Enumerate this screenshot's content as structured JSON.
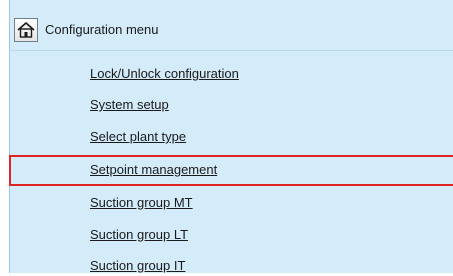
{
  "header": {
    "home_icon": "home-icon",
    "title": "Configuration menu"
  },
  "menu": {
    "items": [
      {
        "label": "Lock/Unlock configuration"
      },
      {
        "label": "System setup"
      },
      {
        "label": "Select plant type"
      },
      {
        "label": "Setpoint management",
        "highlighted": true
      },
      {
        "label": "Suction group MT"
      },
      {
        "label": "Suction group LT"
      },
      {
        "label": "Suction group IT"
      }
    ]
  },
  "colors": {
    "panel_background": "#d4ebfa",
    "highlight_border": "#e02424",
    "text": "#1a1a1a"
  }
}
